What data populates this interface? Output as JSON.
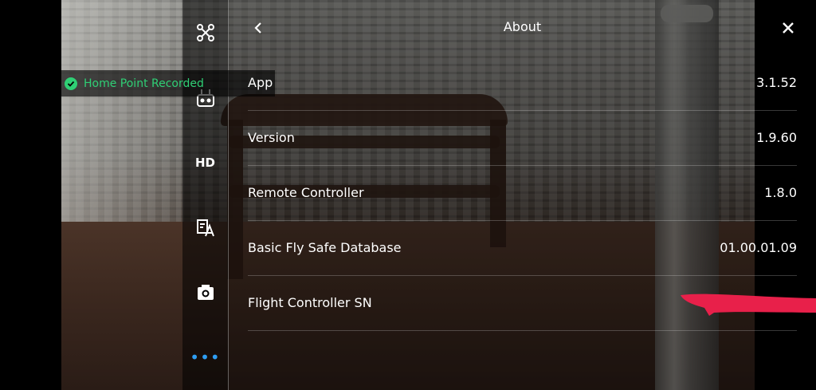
{
  "toast": {
    "text": "Home Point Recorded"
  },
  "side_panel": {
    "hd_label": "HD",
    "more_label": "•••"
  },
  "about": {
    "title": "About",
    "rows": [
      {
        "label": "App",
        "value": "3.1.52"
      },
      {
        "label": "Version",
        "value": "1.9.60"
      },
      {
        "label": "Remote Controller",
        "value": "1.8.0"
      },
      {
        "label": "Basic Fly Safe Database",
        "value": "01.00.01.09"
      },
      {
        "label": "Flight Controller SN",
        "value": ""
      }
    ]
  },
  "colors": {
    "toast_green": "#2fcf75",
    "accent_blue": "#2f9df2",
    "redaction_red": "#e8204a"
  },
  "icons": [
    "aircraft-icon",
    "remote-controller-icon",
    "hd-icon",
    "language-icon",
    "camera-icon",
    "more-icon",
    "back-icon",
    "close-icon",
    "check-icon"
  ]
}
